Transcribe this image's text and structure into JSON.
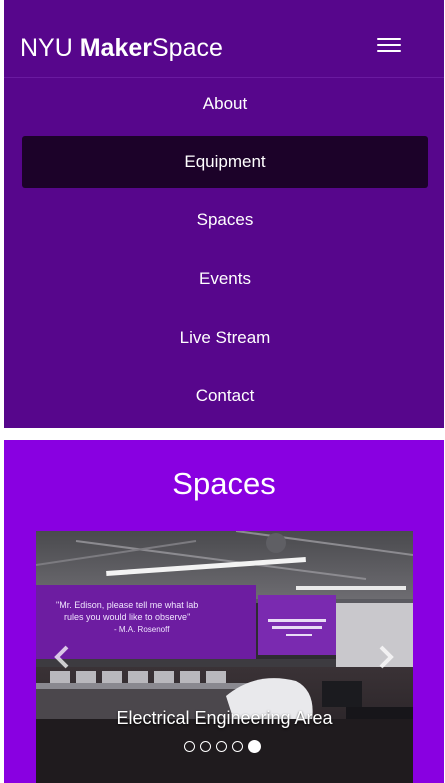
{
  "header": {
    "brand_prefix": "NYU ",
    "brand_bold": "Maker",
    "brand_suffix": "Space",
    "menu_icon": "hamburger-icon"
  },
  "nav": {
    "items": [
      {
        "label": "About",
        "active": false
      },
      {
        "label": "Equipment",
        "active": true
      },
      {
        "label": "Spaces",
        "active": false
      },
      {
        "label": "Events",
        "active": false
      },
      {
        "label": "Live Stream",
        "active": false
      },
      {
        "label": "Contact",
        "active": false
      }
    ]
  },
  "spaces": {
    "title": "Spaces",
    "carousel": {
      "caption": "Electrical Engineering Area",
      "slide_count": 5,
      "active_index": 4,
      "prev_icon": "chevron-left-icon",
      "next_icon": "chevron-right-icon",
      "quote_text_1": "\"Mr. Edison, please tell me what lab",
      "quote_text_2": "rules you would like to observe\"",
      "quote_author": "- M.A. Rosenoff"
    }
  },
  "colors": {
    "nav_bg": "#57068c",
    "nav_active_bg": "#1c0229",
    "section_bg": "#8900e1",
    "text": "#ffffff"
  }
}
